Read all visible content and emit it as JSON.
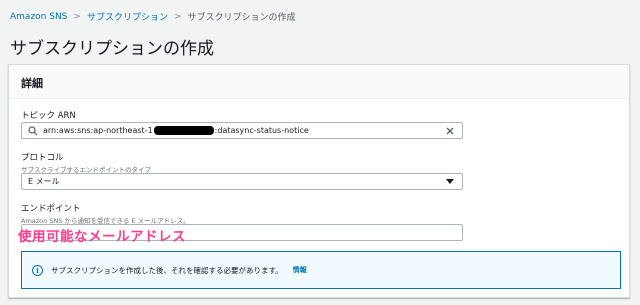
{
  "breadcrumb": {
    "items": [
      "Amazon SNS",
      "サブスクリプション"
    ],
    "separator": ">",
    "current": "サブスクリプションの作成"
  },
  "page": {
    "title": "サブスクリプションの作成"
  },
  "details": {
    "header": "詳細",
    "topic_arn": {
      "label": "トピック ARN",
      "value_prefix": "arn:aws:sns:ap-northeast-1",
      "value_suffix": ":datasync-status-notice"
    },
    "protocol": {
      "label": "プロトコル",
      "description": "サブスクライブするエンドポイントのタイプ",
      "selected": "E メール"
    },
    "endpoint": {
      "label": "エンドポイント",
      "description": "Amazon SNS から通知を受信できる E メールアドレス。",
      "value": ""
    },
    "annotation": "使用可能なメールアドレス",
    "info_alert": {
      "text": "サブスクリプションを作成した後、それを確認する必要があります。",
      "link": "情報"
    }
  },
  "colors": {
    "link": "#0073bb",
    "annotation": "#ff3c8d",
    "background": "#f2f3f3"
  }
}
